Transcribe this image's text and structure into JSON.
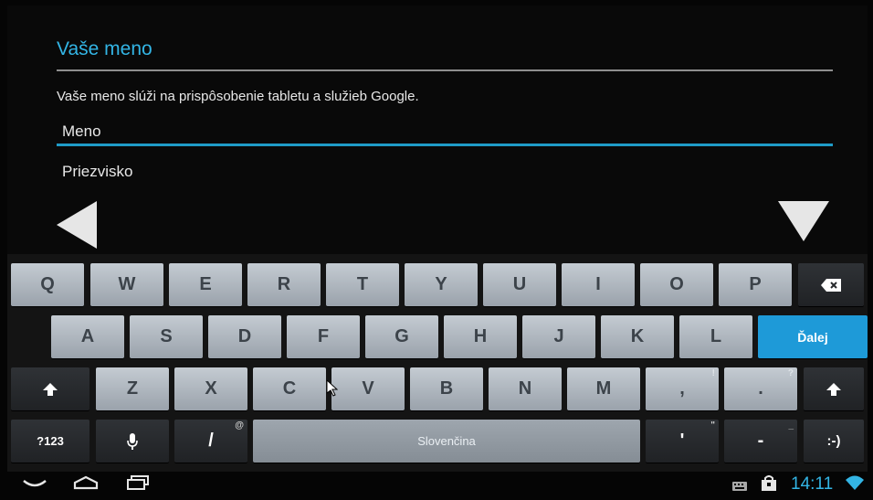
{
  "setup": {
    "title": "Vaše meno",
    "description": "Vaše meno slúži na prispôsobenie tabletu a služieb Google.",
    "first_name_value": "Meno",
    "last_name_placeholder": "Priezvisko"
  },
  "keyboard": {
    "row1": [
      "Q",
      "W",
      "E",
      "R",
      "T",
      "Y",
      "U",
      "I",
      "O",
      "P"
    ],
    "row2": [
      "A",
      "S",
      "D",
      "F",
      "G",
      "H",
      "J",
      "K",
      "L"
    ],
    "row3": [
      "Z",
      "X",
      "C",
      "V",
      "B",
      "N",
      "M"
    ],
    "next_label": "Ďalej",
    "symbols_label": "?123",
    "slash_label": "/",
    "slash_hint": "@",
    "space_label": "Slovenčina",
    "comma_label": ",",
    "comma_hint": "!",
    "period_label": ".",
    "period_hint": "?",
    "apostrophe_label": "'",
    "apostrophe_hint": "\"",
    "dash_label": "-",
    "dash_hint": "_",
    "smiley_label": ":-)"
  },
  "status_bar": {
    "time": "14:11"
  },
  "colors": {
    "accent": "#33b5e5",
    "key_light": "#b3bac2",
    "key_dark": "#26292c",
    "next_key": "#1e9ad8"
  },
  "icons": [
    "back-arrow-icon",
    "next-arrow-icon",
    "backspace-icon",
    "shift-icon",
    "microphone-icon",
    "mouse-cursor-icon",
    "nav-back-icon",
    "home-icon",
    "recent-apps-icon",
    "keyboard-icon",
    "shopping-bag-icon",
    "wifi-icon"
  ]
}
